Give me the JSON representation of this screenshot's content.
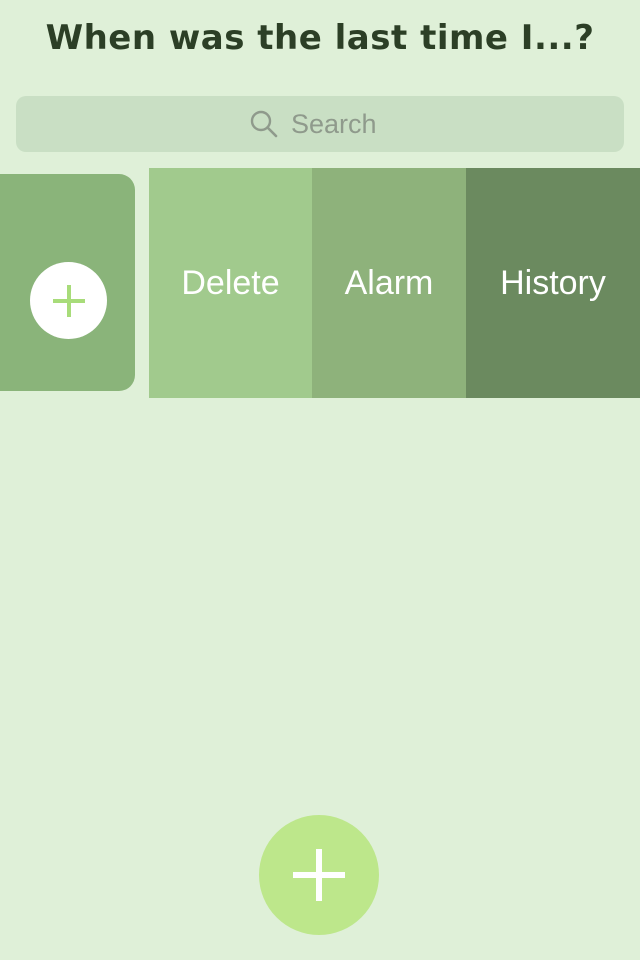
{
  "header": {
    "title": "When was the last time I...?"
  },
  "search": {
    "placeholder": "Search",
    "icon": "search-icon"
  },
  "item_row": {
    "add_icon": "plus-icon",
    "actions": {
      "delete_label": "Delete",
      "alarm_label": "Alarm",
      "history_label": "History"
    }
  },
  "fab": {
    "icon": "plus-icon"
  },
  "colors": {
    "background": "#dff0d8",
    "title": "#2c3f26",
    "search_bar": "#c9dfc4",
    "item_card": "#8ab47a",
    "delete": "#a1ca8d",
    "alarm": "#8eb27b",
    "history": "#6b8a5f",
    "fab": "#bde78b",
    "plus_accent": "#a8dc7a"
  }
}
